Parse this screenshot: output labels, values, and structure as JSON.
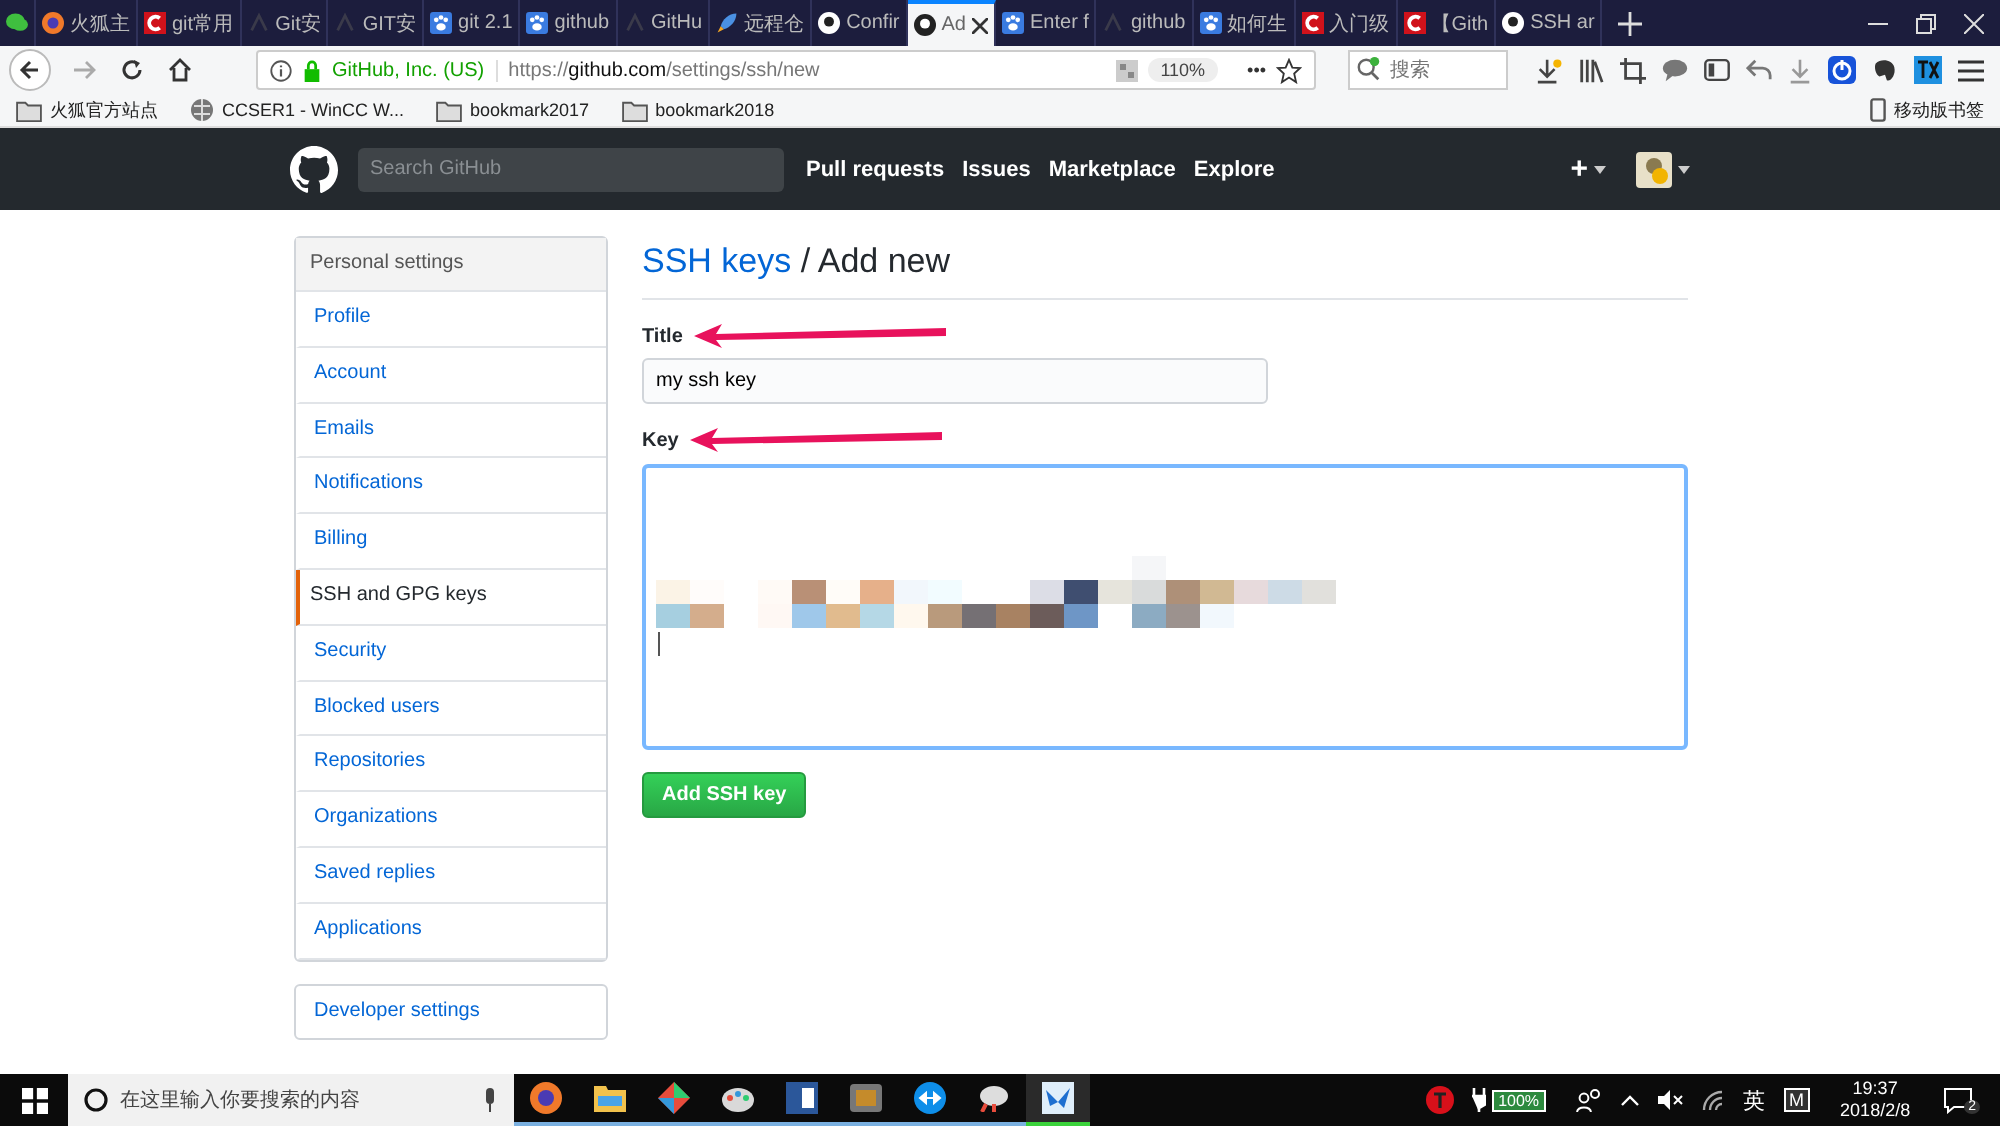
{
  "browser_tabs": [
    {
      "kind": "wechat",
      "selected": false
    },
    {
      "kind": "firefox",
      "label": "火狐主",
      "selected": false
    },
    {
      "kind": "csdn",
      "label": "git常用",
      "selected": false
    },
    {
      "kind": "faint",
      "label": "Git安",
      "selected": false
    },
    {
      "kind": "faint",
      "label": "GIT安",
      "selected": false
    },
    {
      "kind": "paw",
      "label": "git 2.1",
      "selected": false
    },
    {
      "kind": "paw",
      "label": "github",
      "selected": false
    },
    {
      "kind": "faint",
      "label": "GitHu",
      "selected": false
    },
    {
      "kind": "rocket",
      "label": "远程仓",
      "selected": false
    },
    {
      "kind": "github",
      "label": "Confir",
      "selected": false
    },
    {
      "kind": "github",
      "label": "Ad",
      "selected": true
    },
    {
      "kind": "paw",
      "label": "Enter f",
      "selected": false
    },
    {
      "kind": "faint",
      "label": "github",
      "selected": false
    },
    {
      "kind": "paw",
      "label": "如何生",
      "selected": false
    },
    {
      "kind": "csdn",
      "label": "入门级",
      "selected": false
    },
    {
      "kind": "csdn",
      "label": "【Gith",
      "selected": false
    },
    {
      "kind": "github",
      "label": "SSH ar",
      "selected": false
    }
  ],
  "address_bar": {
    "identity": "GitHub, Inc. (US)",
    "url_scheme": "https://",
    "url_domain": "github.com",
    "url_path": "/settings/ssh/new",
    "zoom": "110%",
    "more": "•••"
  },
  "browser_search": {
    "placeholder": "搜索"
  },
  "bookmarks": [
    {
      "kind": "folder",
      "label": "火狐官方站点"
    },
    {
      "kind": "globe",
      "label": "CCSER1 - WinCC W..."
    },
    {
      "kind": "folder",
      "label": "bookmark2017"
    },
    {
      "kind": "folder",
      "label": "bookmark2018"
    }
  ],
  "mobile_bookmarks": "移动版书签",
  "github_header": {
    "search_placeholder": "Search GitHub",
    "nav": [
      "Pull requests",
      "Issues",
      "Marketplace",
      "Explore"
    ],
    "new_menu": "+"
  },
  "sidebar": {
    "heading": "Personal settings",
    "items": [
      {
        "label": "Profile",
        "selected": false
      },
      {
        "label": "Account",
        "selected": false
      },
      {
        "label": "Emails",
        "selected": false
      },
      {
        "label": "Notifications",
        "selected": false
      },
      {
        "label": "Billing",
        "selected": false
      },
      {
        "label": "SSH and GPG keys",
        "selected": true
      },
      {
        "label": "Security",
        "selected": false
      },
      {
        "label": "Blocked users",
        "selected": false
      },
      {
        "label": "Repositories",
        "selected": false
      },
      {
        "label": "Organizations",
        "selected": false
      },
      {
        "label": "Saved replies",
        "selected": false
      },
      {
        "label": "Applications",
        "selected": false
      }
    ],
    "developer_settings": "Developer settings"
  },
  "page_title": {
    "link": "SSH keys",
    "rest": "/ Add new"
  },
  "form": {
    "title_label": "Title",
    "title_value": "my ssh key",
    "key_label": "Key",
    "submit": "Add SSH key"
  },
  "taskbar": {
    "search_placeholder": "在这里输入你要搜索的内容",
    "apps": [
      {
        "kind": "firefox",
        "active": false
      },
      {
        "kind": "folder",
        "active": false
      },
      {
        "kind": "diamond",
        "active": false
      },
      {
        "kind": "palette",
        "active": false
      },
      {
        "kind": "word",
        "active": false
      },
      {
        "kind": "box",
        "active": false
      },
      {
        "kind": "teamviewer",
        "active": false
      },
      {
        "kind": "cloud",
        "active": false
      },
      {
        "kind": "bird",
        "active": true
      }
    ],
    "battery": "100%",
    "ime": "英",
    "ime_mode": "M",
    "time": "19:37",
    "date": "2018/2/8",
    "notifications": "2"
  }
}
